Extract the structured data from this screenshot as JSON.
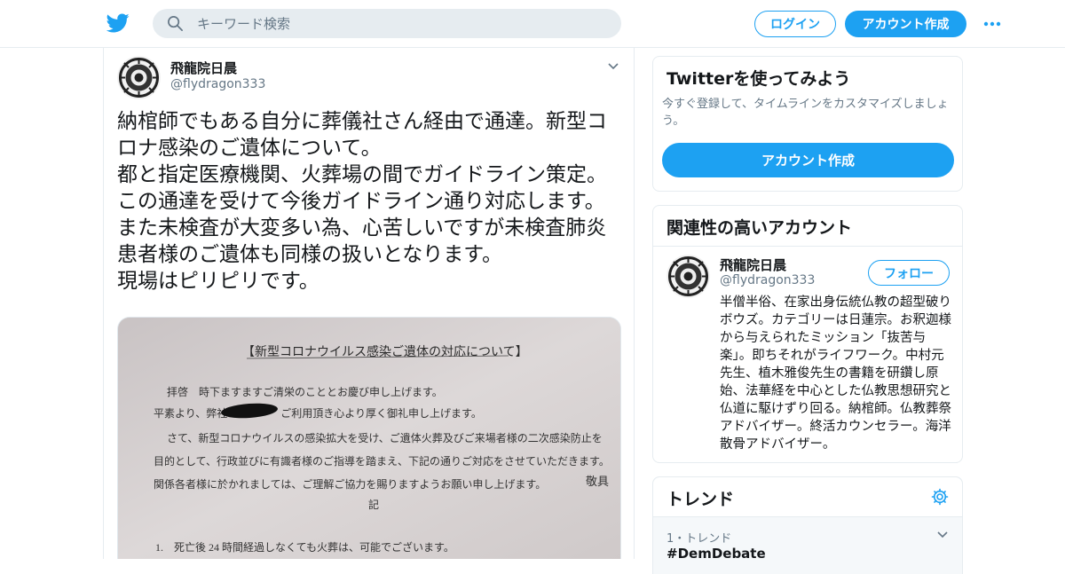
{
  "header": {
    "logo_icon": "twitter-bird-icon",
    "search_placeholder": "キーワード検索",
    "login_label": "ログイン",
    "signup_label": "アカウント作成",
    "more_icon": "more-dots-icon",
    "accent_color": "#1da1f2"
  },
  "tweet": {
    "author_name": "飛龍院日晨",
    "author_handle": "@flydragon333",
    "text": "納棺師でもある自分に葬儀社さん経由で通達。新型コロナ感染のご遺体について。\n都と指定医療機関、火葬場の間でガイドライン策定。\nこの通達を受けて今後ガイドライン通り対応します。\nまた未検査が大変多い為、心苦しいですが未検査肺炎患者様のご遺体も同様の扱いとなります。\n現場はピリピリです。",
    "media": {
      "doc_title": "【新型コロナウイルス感染ご遺体の対応について】",
      "lines": [
        "拝啓　時下ますますご清栄のこととお慶び申し上げます。",
        "平素より、弊社　　　　　ご利用頂き心より厚く御礼申し上げます。",
        "さて、新型コロナウイルスの感染拡大を受け、ご遺体火葬及びご来場者様の二次感染防止を",
        "目的として、行政並びに有識者様のご指導を踏まえ、下記の通りご対応をさせていただきます。",
        "関係各者様に於かれましては、ご理解ご協力を賜りますようお願い申し上げます。"
      ],
      "closing": "敬具",
      "ki": "記",
      "item1": "1.　死亡後 24 時間経過しなくても火葬は、可能でございます。"
    }
  },
  "signup_card": {
    "title": "Twitterを使ってみよう",
    "description": "今すぐ登録して、タイムラインをカスタマイズしましょう。",
    "button_label": "アカウント作成"
  },
  "related_card": {
    "title": "関連性の高いアカウント",
    "account": {
      "name": "飛龍院日晨",
      "handle": "@flydragon333",
      "follow_label": "フォロー",
      "bio": "半僧半俗、在家出身伝統仏教の超型破りボウズ。カテゴリーは日蓮宗。お釈迦様から与えられたミッション「抜苦与楽」。即ちそれがライフワーク。中村元先生、植木雅俊先生の書籍を研鑽し原始、法華経を中心とした仏教思想研究と仏道に駆けずり回る。納棺師。仏教葬祭アドバイザー。終活カウンセラー。海洋散骨アドバイザー。"
    }
  },
  "trends_card": {
    "title": "トレンド",
    "settings_icon": "gear-icon",
    "items": [
      {
        "rank_label": "1・トレンド",
        "tag": "#DemDebate"
      }
    ]
  }
}
